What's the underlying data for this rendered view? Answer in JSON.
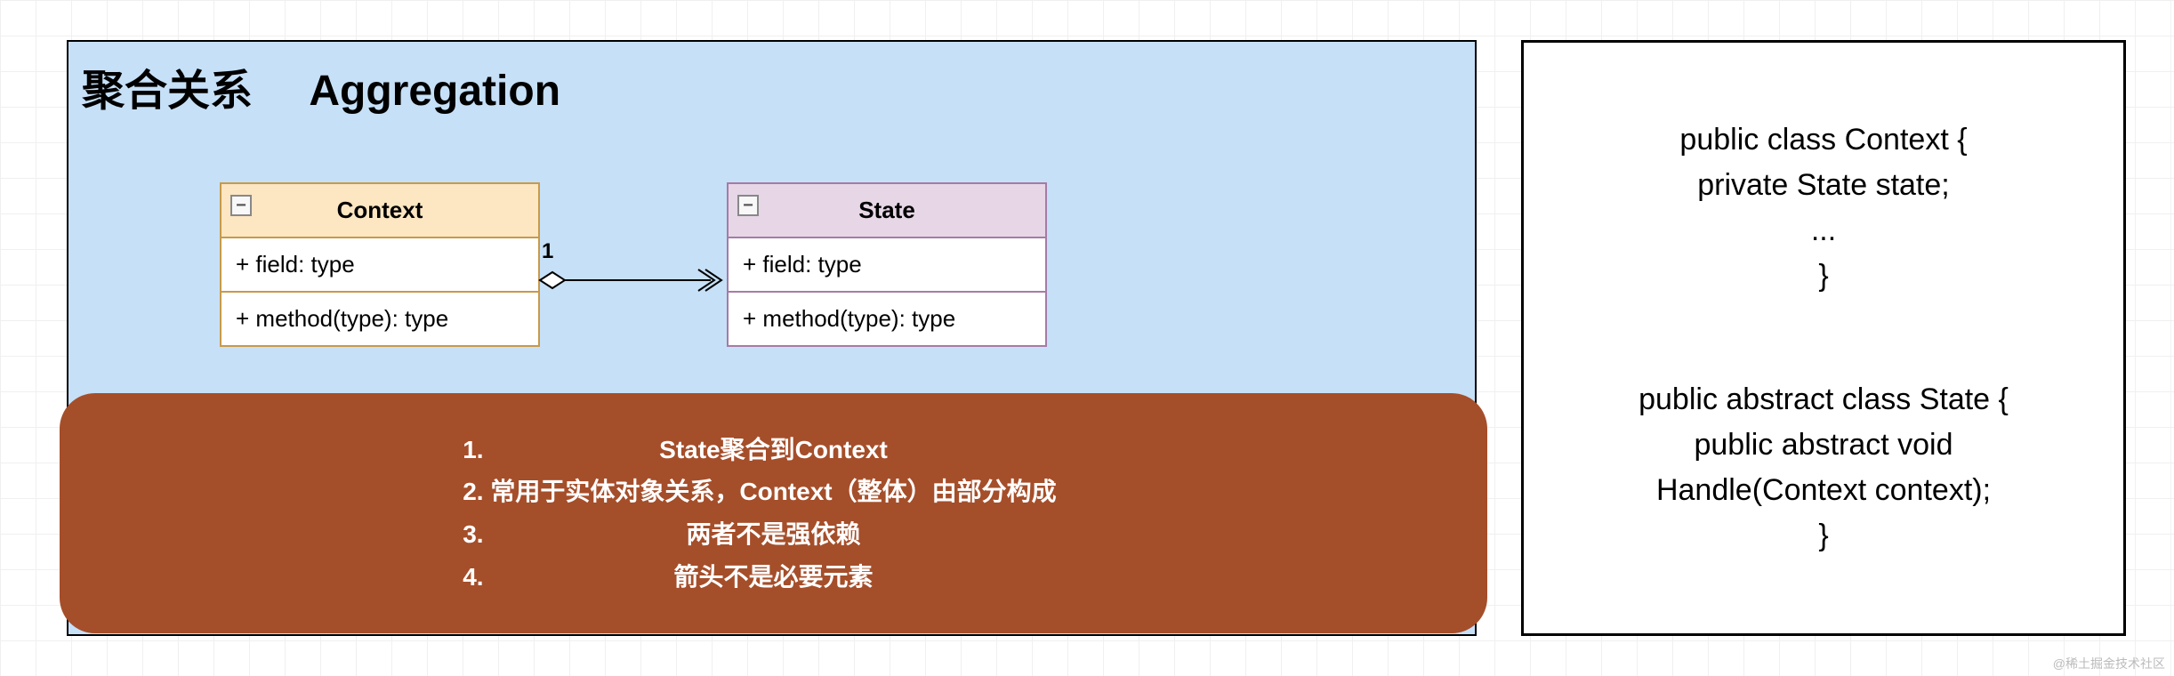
{
  "title": {
    "cn": "聚合关系",
    "en": "Aggregation"
  },
  "classes": {
    "context": {
      "name": "Context",
      "field": "+ field: type",
      "method": "+ method(type): type"
    },
    "state": {
      "name": "State",
      "field": "+ field: type",
      "method": "+ method(type): type"
    }
  },
  "connector": {
    "multiplicity": "1"
  },
  "collapse_glyph": "−",
  "notes": {
    "1": "State聚合到Context",
    "2": "常用于实体对象关系，Context（整体）由部分构成",
    "3": "两者不是强依赖",
    "4": "箭头不是必要元素"
  },
  "code": {
    "block1": "public class Context {\nprivate State state;\n...\n}",
    "block2": "public abstract class State {\npublic abstract void\nHandle(Context context);\n}"
  },
  "watermark": "@稀土掘金技术社区"
}
